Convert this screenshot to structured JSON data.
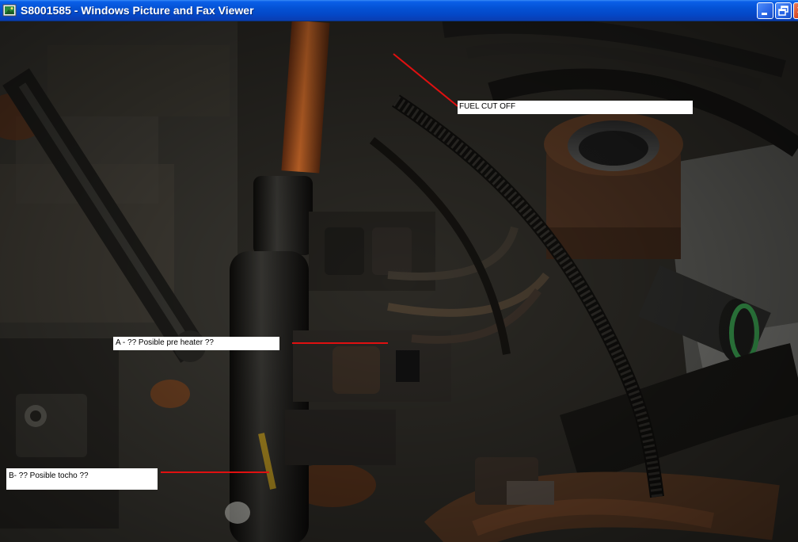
{
  "window": {
    "title": "S8001585 - Windows Picture and Fax Viewer",
    "icon": "picture-viewer-icon",
    "controls": [
      "minimize-icon",
      "restore-icon",
      "close-icon"
    ]
  },
  "photo": {
    "annotations": {
      "fuel_cut_off": "FUEL CUT OFF",
      "pre_heater": "A - ?? Posible pre heater ??",
      "tocho": "B- ?? Posible tocho ??"
    },
    "leader_color": "#e01010"
  }
}
